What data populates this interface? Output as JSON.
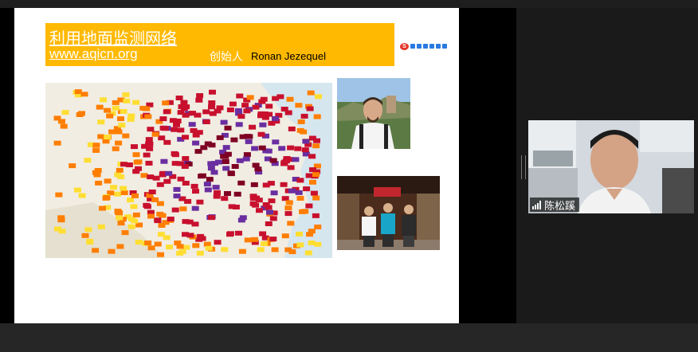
{
  "slide": {
    "title": "利用地面监测网络",
    "url": "www.aqicn.org",
    "founder_label": "创始人",
    "founder_name": "Ronan Jezequel"
  },
  "video": {
    "participant_name": "陈松蹊"
  },
  "icons": {
    "ime_toolbar": "sogou-ime-icon",
    "signal": "signal-strength-icon"
  },
  "colors": {
    "banner": "#ffb900",
    "aqi_red": "#c8102e",
    "aqi_purple": "#6a2ea0",
    "aqi_maroon": "#7e0023",
    "aqi_orange": "#ff7e00",
    "aqi_yellow": "#ffde33"
  }
}
